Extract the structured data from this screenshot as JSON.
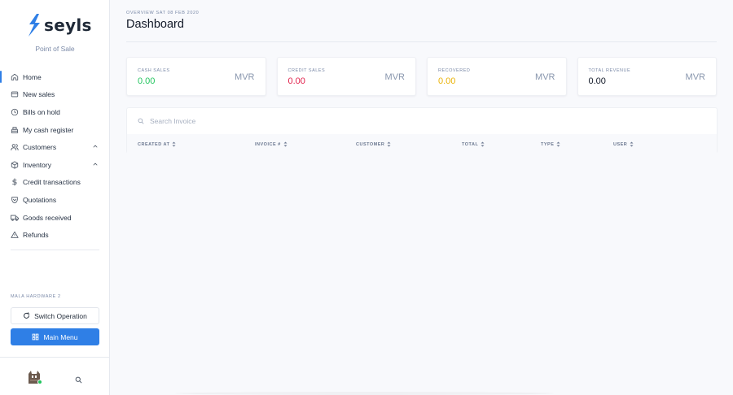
{
  "brand": {
    "name": "seyls",
    "subtitle": "Point of Sale",
    "accent": "#2f7fe6"
  },
  "sidebar": {
    "items": [
      {
        "label": "Home",
        "icon": "home-icon",
        "active": true
      },
      {
        "label": "New sales",
        "icon": "receipt-icon"
      },
      {
        "label": "Bills on hold",
        "icon": "clock-icon"
      },
      {
        "label": "My cash register",
        "icon": "cash-register-icon"
      },
      {
        "label": "Customers",
        "icon": "users-icon",
        "expandable": true
      },
      {
        "label": "Inventory",
        "icon": "box-icon",
        "expandable": true
      },
      {
        "label": "Credit transactions",
        "icon": "dollar-icon"
      },
      {
        "label": "Quotations",
        "icon": "shield-icon"
      },
      {
        "label": "Goods received",
        "icon": "truck-icon"
      },
      {
        "label": "Refunds",
        "icon": "alert-triangle-icon"
      }
    ],
    "operation_label": "MALA HARDWARE 2",
    "switch_label": "Switch Operation",
    "main_menu_label": "Main Menu"
  },
  "header": {
    "eyebrow": "OVERVIEW SAT 08 FEB 2020",
    "title": "Dashboard"
  },
  "cards": [
    {
      "label": "CASH SALES",
      "value": "0.00",
      "currency": "MVR",
      "color": "#22c55e"
    },
    {
      "label": "CREDIT SALES",
      "value": "0.00",
      "currency": "MVR",
      "color": "#e11d48"
    },
    {
      "label": "RECOVERED",
      "value": "0.00",
      "currency": "MVR",
      "color": "#eab308"
    },
    {
      "label": "TOTAL REVENUE",
      "value": "0.00",
      "currency": "MVR",
      "color": "#111827"
    }
  ],
  "invoices": {
    "search_placeholder": "Search Invoice",
    "columns": [
      "CREATED AT",
      "INVOICE #",
      "CUSTOMER",
      "TOTAL",
      "TYPE",
      "USER"
    ],
    "rows": []
  }
}
